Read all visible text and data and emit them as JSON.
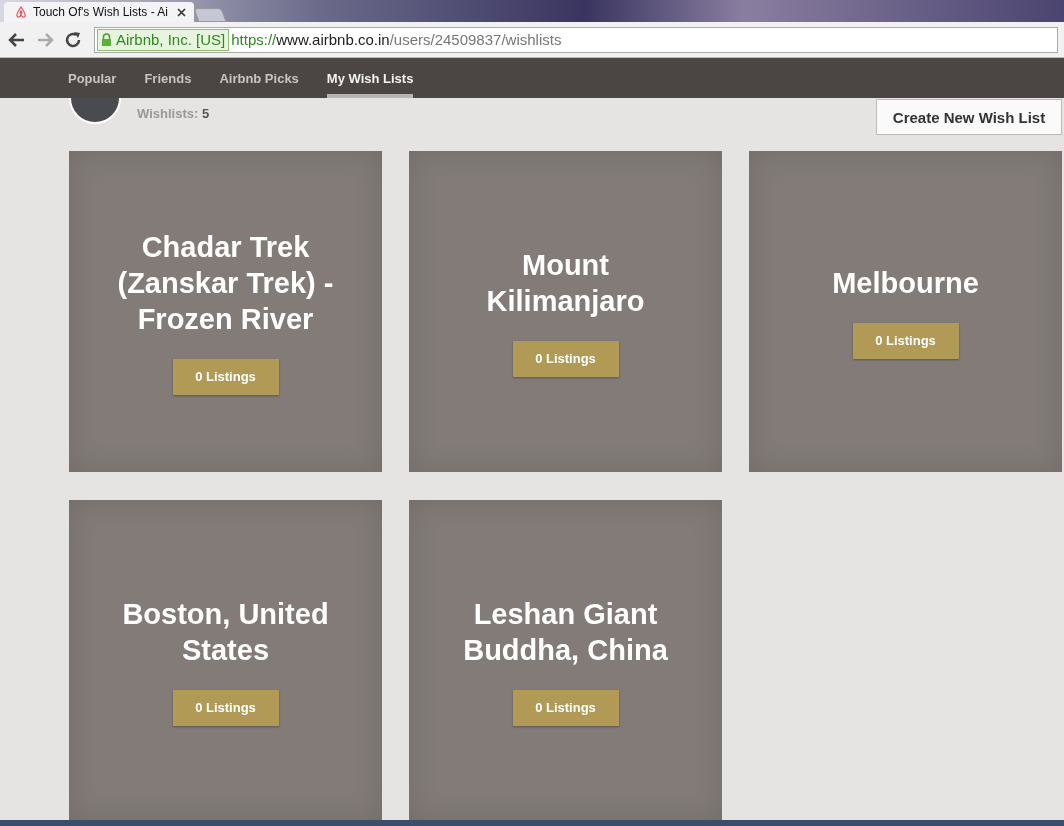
{
  "browser": {
    "tabs": [
      {
        "title": "Touch Of's Wish Lists - Ai",
        "selected": true
      },
      {
        "selected": false
      }
    ],
    "address": {
      "identity": "Airbnb, Inc. [US]",
      "scheme": "https://",
      "host": "www.airbnb.co.in",
      "path": "/users/24509837/wishlists"
    }
  },
  "nav": {
    "items": [
      {
        "label": "Popular",
        "selected": false
      },
      {
        "label": "Friends",
        "selected": false
      },
      {
        "label": "Airbnb Picks",
        "selected": false
      },
      {
        "label": "My Wish Lists",
        "selected": true
      }
    ]
  },
  "profile": {
    "wishlists_label": "Wishlists:",
    "wishlists_count": "5"
  },
  "create_button": "Create New Wish List",
  "wishlists": [
    {
      "title": "Chadar Trek (Zanskar Trek) - Frozen River",
      "listings": "0 Listings"
    },
    {
      "title": "Mount Kilimanjaro",
      "listings": "0 Listings"
    },
    {
      "title": "Melbourne",
      "listings": "0 Listings"
    },
    {
      "title": "Boston, United States",
      "listings": "0 Listings"
    },
    {
      "title": "Leshan Giant Buddha, China",
      "listings": "0 Listings"
    }
  ]
}
